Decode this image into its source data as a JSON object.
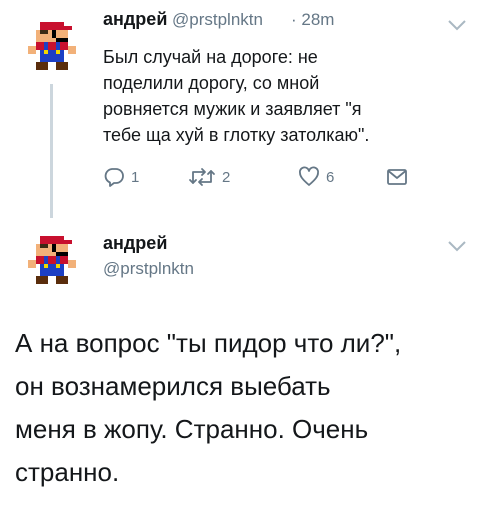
{
  "tweet1": {
    "name": "андрей",
    "handle": "@prstplnktn",
    "time": "· 28m",
    "lines": [
      "Был случай на дороге: не",
      "поделили дорогу, со мной",
      "ровняется мужик и заявляет \"я",
      "тебе ща хуй в глотку затолкаю\"."
    ],
    "reply_count": "1",
    "retweet_count": "2",
    "like_count": "6"
  },
  "tweet2": {
    "name": "андрей",
    "handle": "@prstplnktn",
    "lines": [
      "А на вопрос \"ты пидор что ли?\",",
      "он вознамерился выебать",
      "меня в жопу. Странно. Очень",
      "странно."
    ]
  },
  "colors": {
    "text": "#14171a",
    "muted": "#657786",
    "thread_line": "#ccd6dd",
    "mario_red": "#c8102e",
    "mario_blue": "#1c3fc4",
    "mario_skin": "#f2b179"
  },
  "icons": {
    "avatar": "mario-avatar",
    "menu": "chevron-down-icon",
    "reply": "reply-icon",
    "retweet": "retweet-icon",
    "like": "heart-icon",
    "dm": "envelope-icon"
  }
}
